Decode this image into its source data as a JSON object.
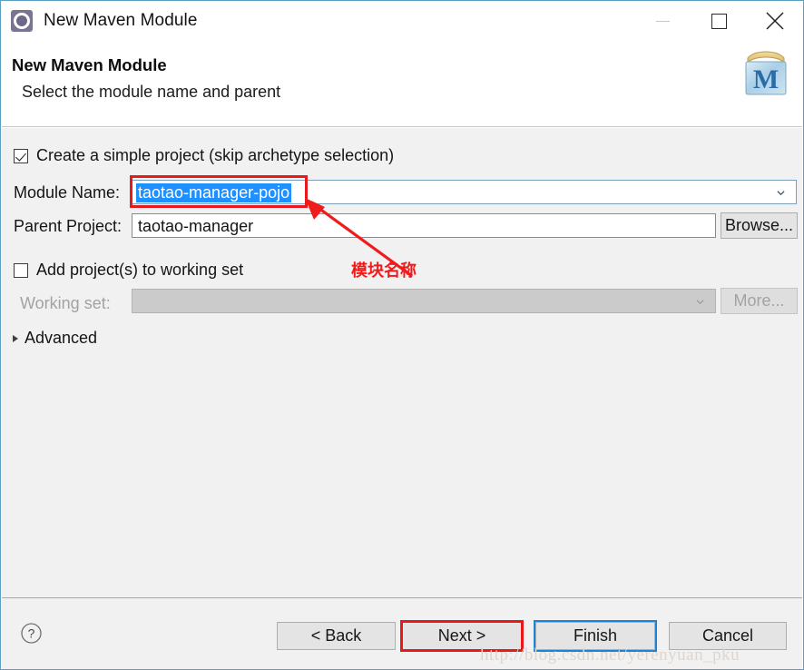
{
  "window": {
    "title": "New Maven Module",
    "icon": "maven-module-gear-icon",
    "controls": {
      "minimize": "minimize-icon",
      "maximize": "maximize-icon",
      "close": "close-icon"
    }
  },
  "header": {
    "title": "New Maven Module",
    "subtitle": "Select the module name and parent",
    "logo_letter": "M",
    "logo_name": "maven-logo"
  },
  "form": {
    "simple_project": {
      "label": "Create a simple project (skip archetype selection)",
      "checked": true
    },
    "module_name": {
      "label": "Module Name:",
      "value": "taotao-manager-pojo",
      "selected": true
    },
    "parent_project": {
      "label": "Parent Project:",
      "value": "taotao-manager",
      "browse_label": "Browse..."
    },
    "add_to_working_set": {
      "label": "Add project(s) to working set",
      "checked": false
    },
    "working_set": {
      "label": "Working set:",
      "value": "",
      "more_label": "More...",
      "disabled": true
    },
    "advanced": {
      "label": "Advanced",
      "expanded": false
    }
  },
  "footer": {
    "help": "help-icon",
    "buttons": [
      {
        "label": "< Back",
        "name": "back-button",
        "enabled": true
      },
      {
        "label": "Next >",
        "name": "next-button",
        "enabled": true
      },
      {
        "label": "Finish",
        "name": "finish-button",
        "enabled": true,
        "focused": true
      },
      {
        "label": "Cancel",
        "name": "cancel-button",
        "enabled": true
      }
    ]
  },
  "annotations": {
    "module_name_note": "模块名称",
    "highlight_color": "#e8191b",
    "focus_color": "#1b84d6",
    "selection_color": "#1e90ff"
  },
  "watermark": "http://blog.csdn.net/yerenyuan_pku"
}
